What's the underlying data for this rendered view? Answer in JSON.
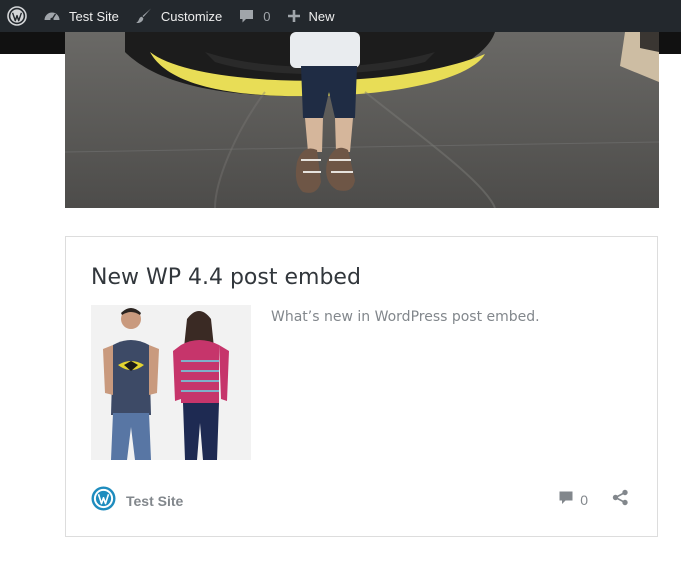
{
  "adminbar": {
    "wp_icon": "wordpress-logo-icon",
    "site_icon": "dashboard-icon",
    "site_label": "Test Site",
    "customize_icon": "brush-icon",
    "customize_label": "Customize",
    "comments_icon": "comment-bubble-icon",
    "comments_count": "0",
    "new_icon": "plus-icon",
    "new_label": "New"
  },
  "embed": {
    "title": "New WP 4.4 post embed",
    "excerpt": "What’s new in WordPress post embed.",
    "site_name": "Test Site",
    "site_icon": "wordpress-logo-icon",
    "comments_icon": "comment-bubble-icon",
    "comments_count": "0",
    "share_icon": "share-icon"
  },
  "colors": {
    "adminbar_bg": "#23282d",
    "text_dark": "#32373c",
    "text_muted": "#82878c",
    "border": "#dddddd"
  }
}
